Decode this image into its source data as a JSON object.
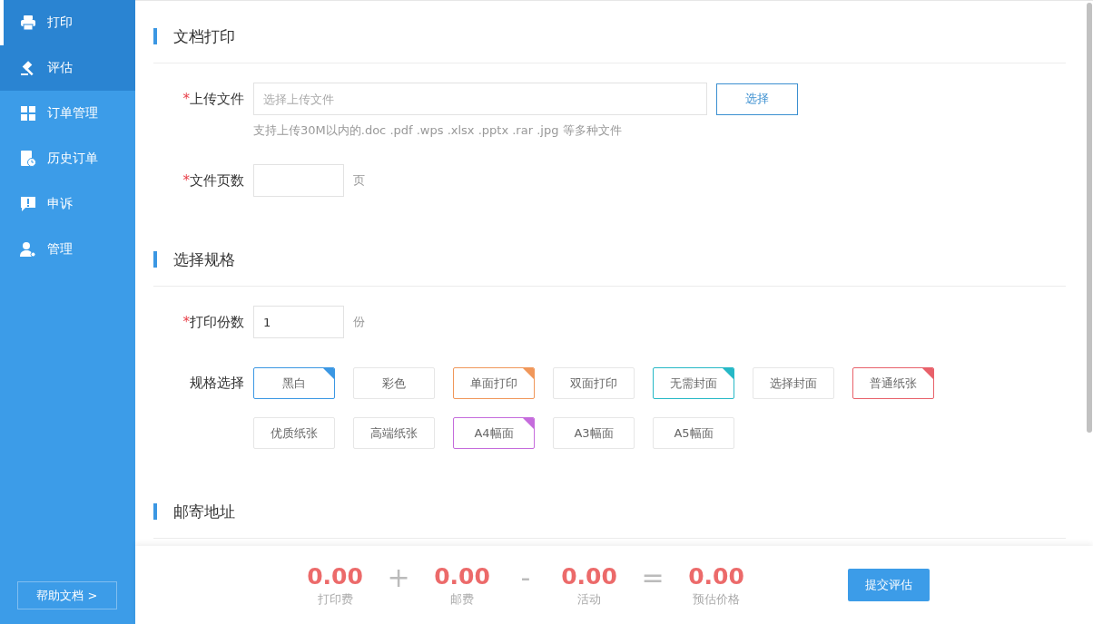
{
  "sidebar": {
    "items": [
      {
        "kind": "printer",
        "label": "打印",
        "selected": true,
        "hovered": true
      },
      {
        "kind": "gavel",
        "label": "评估",
        "selected": true,
        "hovered": false
      },
      {
        "kind": "grid",
        "label": "订单管理",
        "selected": false,
        "hovered": false
      },
      {
        "kind": "history",
        "label": "历史订单",
        "selected": false,
        "hovered": false
      },
      {
        "kind": "alert",
        "label": "申诉",
        "selected": false,
        "hovered": false
      },
      {
        "kind": "user",
        "label": "管理",
        "selected": false,
        "hovered": false
      }
    ],
    "help_button": "帮助文档 >"
  },
  "sections": [
    {
      "title": "文档打印",
      "fields": [
        {
          "kind": "file",
          "label": "上传文件",
          "required_mark": "*",
          "placeholder": "选择上传文件",
          "button": "选择",
          "hint": "支持上传30M以内的.doc .pdf .wps .xlsx .pptx .rar .jpg 等多种文件"
        },
        {
          "kind": "number",
          "label": "文件页数",
          "required_mark": "*",
          "unit": "页"
        }
      ]
    },
    {
      "title": "选择规格",
      "fields": [
        {
          "kind": "number",
          "label": "打印份数",
          "required_mark": "*",
          "value": "1",
          "unit": "份"
        },
        {
          "kind": "options",
          "label": "规格选择",
          "options": [
            {
              "label": "黑白",
              "selected": true,
              "color": "#3b97e3"
            },
            {
              "label": "彩色",
              "selected": false
            },
            {
              "label": "单面打印",
              "selected": true,
              "color": "#f0975a"
            },
            {
              "label": "双面打印",
              "selected": false
            },
            {
              "label": "无需封面",
              "selected": true,
              "color": "#26b8c6"
            },
            {
              "label": "选择封面",
              "selected": false
            },
            {
              "label": "普通纸张",
              "selected": true,
              "color": "#e8616a"
            },
            {
              "label": "优质纸张",
              "selected": false
            },
            {
              "label": "高端纸张",
              "selected": false
            },
            {
              "label": "A4幅面",
              "selected": true,
              "color": "#c56cdc"
            },
            {
              "label": "A3幅面",
              "selected": false
            },
            {
              "label": "A5幅面",
              "selected": false
            }
          ]
        }
      ]
    },
    {
      "title": "邮寄地址"
    }
  ],
  "footer": {
    "terms": [
      {
        "kind": "value",
        "amount": "0.00",
        "caption": "打印费"
      },
      {
        "kind": "operator",
        "symbol": "+"
      },
      {
        "kind": "value",
        "amount": "0.00",
        "caption": "邮费"
      },
      {
        "kind": "operator",
        "symbol": "-"
      },
      {
        "kind": "value",
        "amount": "0.00",
        "caption": "活动"
      },
      {
        "kind": "operator",
        "symbol": "="
      },
      {
        "kind": "value",
        "amount": "0.00",
        "caption": "预估价格"
      }
    ],
    "submit_button": "提交评估"
  }
}
